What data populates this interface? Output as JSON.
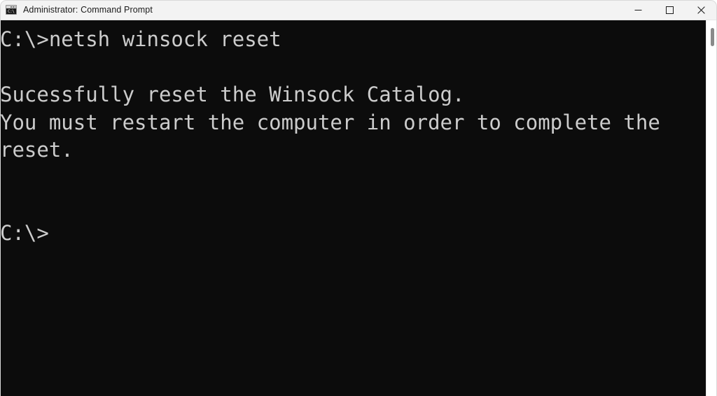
{
  "window": {
    "title": "Administrator: Command Prompt",
    "app_icon": "command-prompt-icon",
    "icon_glyph": "C:\\",
    "controls": {
      "minimize_label": "Minimize",
      "maximize_label": "Maximize",
      "close_label": "Close"
    },
    "colors": {
      "titlebar_bg": "#f3f3f3",
      "titlebar_text": "#1b1b1b",
      "console_bg": "#0c0c0c",
      "console_text": "#cccccc",
      "scrollbar_track": "#ffffff",
      "scrollbar_thumb": "#8a8a8a"
    }
  },
  "console": {
    "lines": [
      "C:\\>netsh winsock reset",
      "",
      "Sucessfully reset the Winsock Catalog.",
      "You must restart the computer in order to complete the",
      "reset.",
      "",
      "",
      "C:\\>"
    ],
    "text": "C:\\>netsh winsock reset\n\nSucessfully reset the Winsock Catalog.\nYou must restart the computer in order to complete the\nreset.\n\n\nC:\\>",
    "prompt": "C:\\>",
    "command": "netsh winsock reset"
  },
  "scrollbar": {
    "name": "vertical-scrollbar",
    "thumb_position": "top"
  }
}
